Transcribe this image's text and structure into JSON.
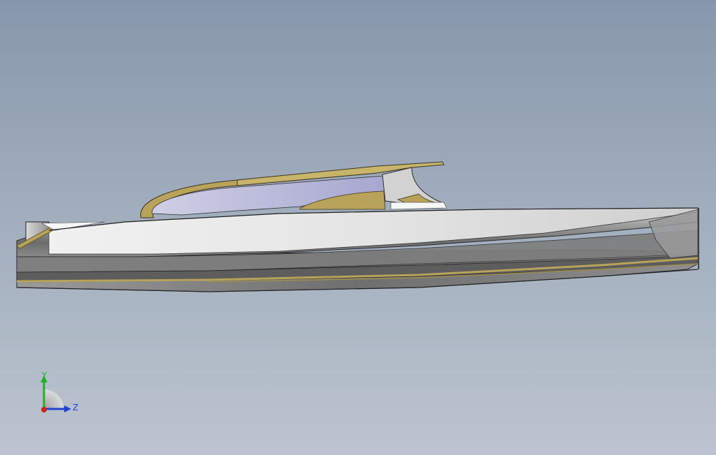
{
  "model": {
    "name": "boat-hull",
    "colors": {
      "hull_light": "#e2e2e2",
      "hull_mid": "#b9b9b9",
      "hull_dark": "#5e5e5e",
      "trim_gold": "#b9a35a",
      "glass": "#b7b7d9",
      "edge": "#1e1e1e"
    }
  },
  "triad": {
    "y_label": "Y",
    "z_label": "Z",
    "colors": {
      "y": "#22b02b",
      "z": "#2244cc",
      "x": "#cc2222"
    }
  }
}
